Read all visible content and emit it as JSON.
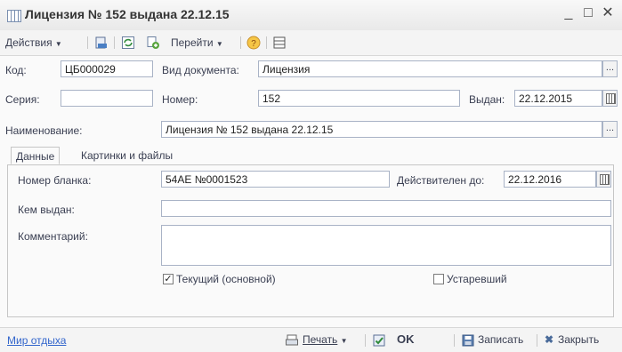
{
  "window": {
    "title": "Лицензия  № 152 выдана 22.12.15",
    "minimize": "_",
    "maximize": "□",
    "close": "✕"
  },
  "toolbar": {
    "actions": "Действия",
    "goto": "Перейти"
  },
  "form": {
    "code_label": "Код:",
    "code_value": "ЦБ000029",
    "doctype_label": "Вид документа:",
    "doctype_value": "Лицензия",
    "series_label": "Серия:",
    "series_value": "",
    "number_label": "Номер:",
    "number_value": "152",
    "issued_label": "Выдан:",
    "issued_value": "22.12.2015",
    "name_label": "Наименование:",
    "name_value": "Лицензия  № 152 выдана 22.12.15"
  },
  "tabs": [
    {
      "label": "Данные"
    },
    {
      "label": "Картинки и файлы"
    }
  ],
  "data_tab": {
    "blank_label": "Номер бланка:",
    "blank_value": "54АЕ №0001523",
    "valid_label": "Действителен до:",
    "valid_value": "22.12.2016",
    "issuer_label": "Кем выдан:",
    "issuer_value": "",
    "comment_label": "Комментарий:",
    "comment_value": "",
    "current_label": "Текущий (основной)",
    "current_checked": true,
    "obsolete_label": "Устаревший",
    "obsolete_checked": false
  },
  "status": {
    "link": "Мир отдыха",
    "print": "Печать",
    "ok": "OK",
    "save": "Записать",
    "close": "Закрыть"
  }
}
